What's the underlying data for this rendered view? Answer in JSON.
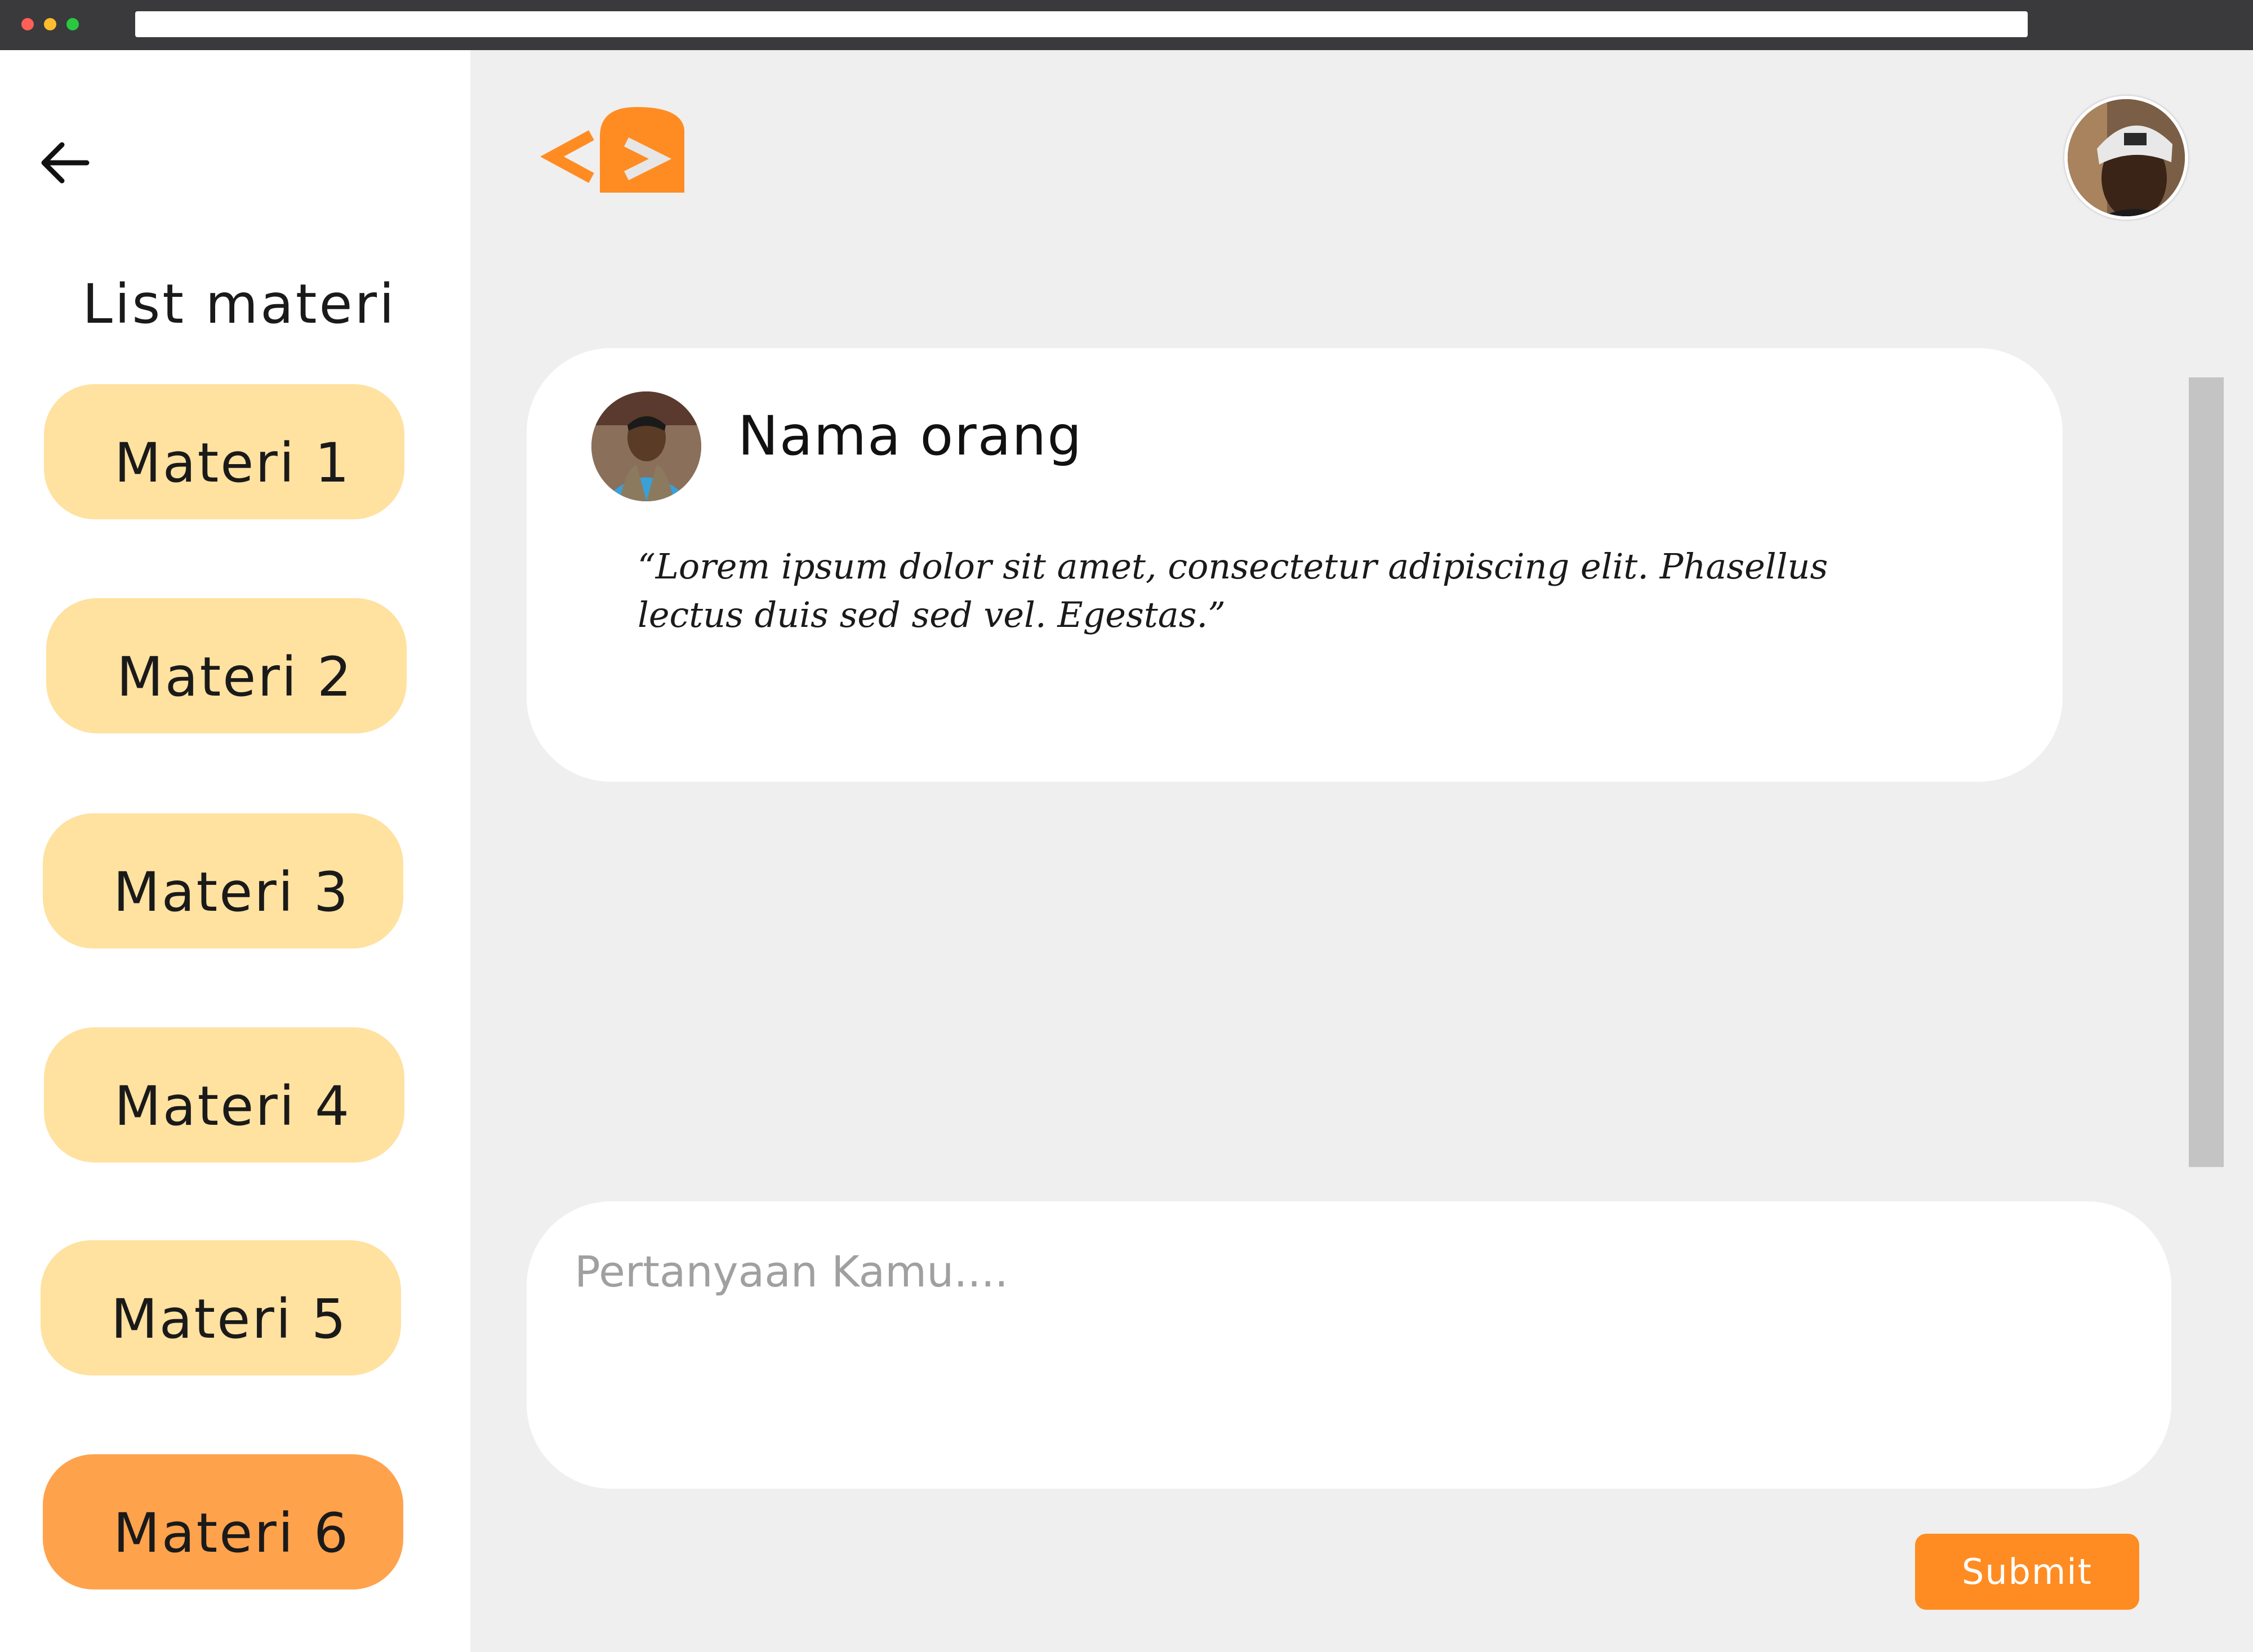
{
  "sidebar": {
    "title": "List materi",
    "items": [
      {
        "label": "Materi 1",
        "active": false
      },
      {
        "label": "Materi 2",
        "active": false
      },
      {
        "label": "Materi 3",
        "active": false
      },
      {
        "label": "Materi 4",
        "active": false
      },
      {
        "label": "Materi 5",
        "active": false
      },
      {
        "label": "Materi 6",
        "active": true
      }
    ]
  },
  "post": {
    "name": "Nama orang",
    "quote": "“Lorem ipsum dolor sit amet, consectetur adipiscing elit. Phasellus lectus duis sed sed vel. Egestas.”"
  },
  "question": {
    "placeholder": "Pertanyaan Kamu...."
  },
  "submit_label": "Submit",
  "colors": {
    "accent": "#ff8c22",
    "materi_bg": "#ffe1a0",
    "materi_active_bg": "#ffa24c",
    "page_bg": "#efefef"
  },
  "icons": {
    "back": "arrow-left-icon",
    "logo": "code-bracket-logo"
  }
}
